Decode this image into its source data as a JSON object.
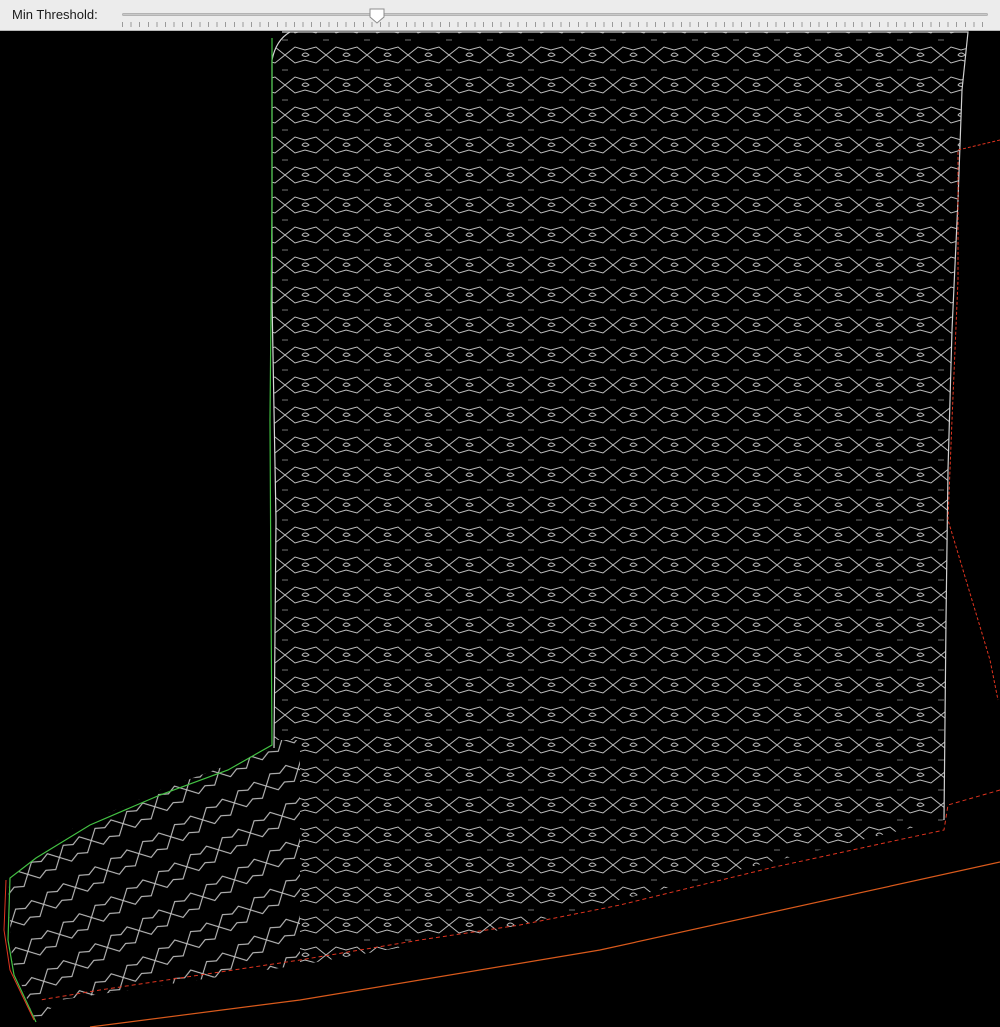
{
  "toolbar": {
    "label": "Min Threshold:",
    "slider_value_fraction": 0.295
  },
  "image": {
    "description_colors": {
      "edge": "#c9c9c9",
      "left_boundary": "#3fbf3f",
      "bottom_boundary": "#e0341f",
      "background": "#000000"
    }
  }
}
